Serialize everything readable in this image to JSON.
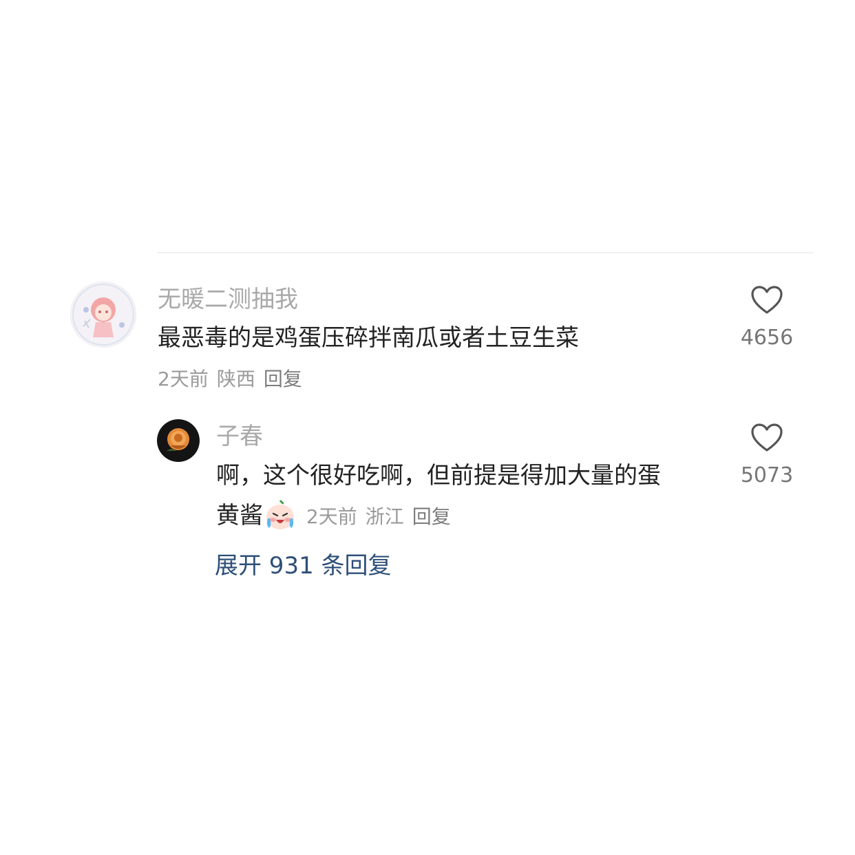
{
  "comments": [
    {
      "username": "无暖二测抽我",
      "text": "最恶毒的是鸡蛋压碎拌南瓜或者土豆生菜",
      "time": "2天前",
      "location": "陕西",
      "reply_label": "回复",
      "like_count": "4656"
    }
  ],
  "reply": {
    "username": "子春",
    "text_line1": "啊，这个很好吃啊，但前提是得加大量的蛋",
    "text_line2": "黄酱",
    "emoji": "crying-laughing-emoji",
    "time": "2天前",
    "location": "浙江",
    "reply_label": "回复",
    "like_count": "5073"
  },
  "expand_label": "展开 931 条回复",
  "colors": {
    "link": "#2e4f78",
    "username": "#a9a9a9",
    "body_text": "#222222",
    "meta": "#9a9a9a"
  }
}
